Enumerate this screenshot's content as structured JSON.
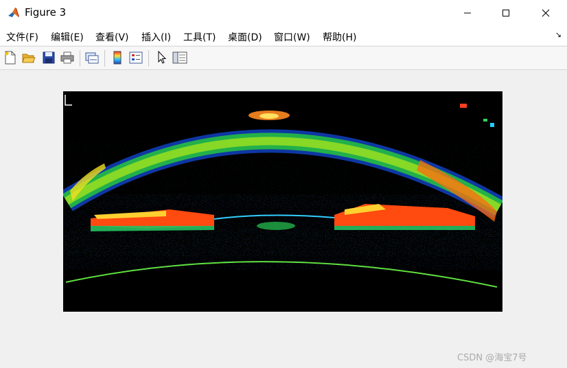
{
  "window": {
    "title": "Figure 3"
  },
  "menu": [
    "文件(F)",
    "编辑(E)",
    "查看(V)",
    "插入(I)",
    "工具(T)",
    "桌面(D)",
    "窗口(W)",
    "帮助(H)"
  ],
  "toolbar": {
    "buttons": [
      "new-figure",
      "open-file",
      "save-figure",
      "print-figure",
      "link-plot",
      "insert-colorbar",
      "insert-legend",
      "edit-plot",
      "open-property-inspector"
    ]
  },
  "image": {
    "colormap": "jet",
    "background": "#000000"
  },
  "watermark": "CSDN @海宝7号"
}
